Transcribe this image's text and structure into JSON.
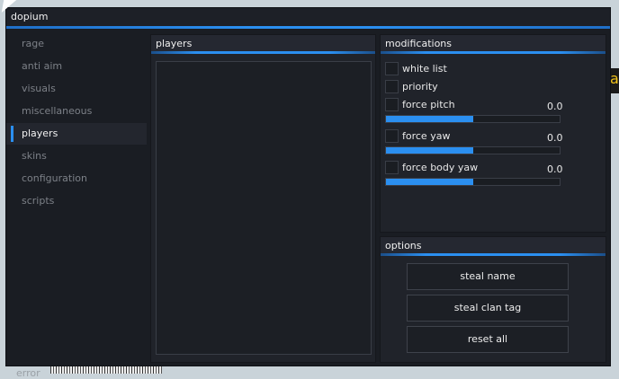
{
  "window": {
    "title": "dopium"
  },
  "background": {
    "edge_letter": "a"
  },
  "sidebar": {
    "items": [
      {
        "label": "rage",
        "active": false
      },
      {
        "label": "anti aim",
        "active": false
      },
      {
        "label": "visuals",
        "active": false
      },
      {
        "label": "miscellaneous",
        "active": false
      },
      {
        "label": "players",
        "active": true
      },
      {
        "label": "skins",
        "active": false
      },
      {
        "label": "configuration",
        "active": false
      },
      {
        "label": "scripts",
        "active": false
      }
    ],
    "status": "error"
  },
  "players_panel": {
    "title": "players"
  },
  "modifications": {
    "title": "modifications",
    "white_list": {
      "label": "white list",
      "checked": false
    },
    "priority": {
      "label": "priority",
      "checked": false
    },
    "force_pitch": {
      "label": "force pitch",
      "checked": false,
      "value": "0.0",
      "fill": 0.5
    },
    "force_yaw": {
      "label": "force yaw",
      "checked": false,
      "value": "0.0",
      "fill": 0.5
    },
    "force_body_yaw": {
      "label": "force body yaw",
      "checked": false,
      "value": "0.0",
      "fill": 0.5
    }
  },
  "options": {
    "title": "options",
    "steal_name": "steal name",
    "steal_clan_tag": "steal clan tag",
    "reset_all": "reset all"
  },
  "colors": {
    "accent": "#2b8ff0",
    "window_bg": "#1a1d23",
    "panel_bg": "#20232a"
  }
}
